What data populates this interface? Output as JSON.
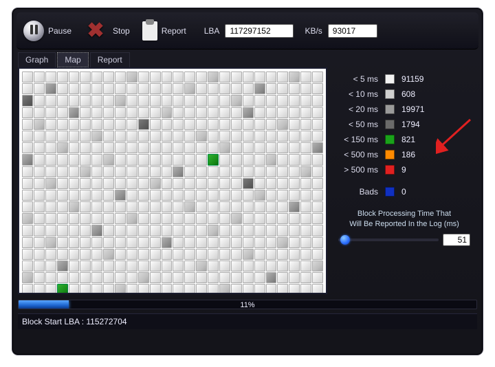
{
  "toolbar": {
    "pause_label": "Pause",
    "stop_label": "Stop",
    "report_label": "Report",
    "lba_label": "LBA",
    "lba_value": "117297152",
    "kbs_label": "KB/s",
    "kbs_value": "93017"
  },
  "tabs": {
    "graph": "Graph",
    "map": "Map",
    "report": "Report",
    "active": "map"
  },
  "legend": [
    {
      "threshold": "< 5 ms",
      "color": "#f2f2f2",
      "count": "91159"
    },
    {
      "threshold": "< 10 ms",
      "color": "#cfcfcf",
      "count": "608"
    },
    {
      "threshold": "< 20 ms",
      "color": "#9a9a9a",
      "count": "19971"
    },
    {
      "threshold": "< 50 ms",
      "color": "#6a6a6a",
      "count": "1794"
    },
    {
      "threshold": "< 150 ms",
      "color": "#1aa21a",
      "count": "821"
    },
    {
      "threshold": "< 500 ms",
      "color": "#ff8a00",
      "count": "186"
    },
    {
      "threshold": "> 500 ms",
      "color": "#e02020",
      "count": "9"
    },
    {
      "threshold": "Bads",
      "color": "#1030c0",
      "count": "0"
    }
  ],
  "slider": {
    "note_line1": "Block Processing Time That",
    "note_line2": "Will Be Reported In the Log (ms)",
    "value": "51",
    "pct": 2
  },
  "progress": {
    "percent_text": "11%",
    "percent": 11
  },
  "status": {
    "label": "Block Start LBA : 115272704"
  },
  "map": {
    "cols": 26,
    "rows": 19,
    "overrides": {
      "0-9": "g1",
      "0-16": "g1",
      "0-23": "g1",
      "1-2": "g2",
      "1-14": "g1",
      "1-20": "g2",
      "2-0": "g3",
      "2-8": "g1",
      "2-18": "g1",
      "3-4": "g2",
      "3-12": "g1",
      "3-19": "g2",
      "4-1": "g1",
      "4-10": "g3",
      "4-22": "g1",
      "5-6": "g1",
      "5-15": "g1",
      "6-3": "g1",
      "6-17": "g1",
      "6-25": "g2",
      "7-0": "g2",
      "7-7": "g1",
      "7-16": "green",
      "7-21": "g1",
      "8-5": "g1",
      "8-13": "g2",
      "8-24": "g1",
      "9-2": "g1",
      "9-11": "g1",
      "9-19": "g3",
      "10-8": "g2",
      "10-20": "g1",
      "11-4": "g1",
      "11-14": "g1",
      "11-23": "g2",
      "12-0": "g1",
      "12-9": "g1",
      "12-18": "g1",
      "13-6": "g2",
      "13-16": "g1",
      "14-2": "g1",
      "14-12": "g2",
      "14-22": "g1",
      "15-7": "g1",
      "15-19": "g1",
      "16-3": "g2",
      "16-15": "g1",
      "16-25": "g1",
      "17-0": "g1",
      "17-10": "g1",
      "17-21": "g2",
      "18-3": "green",
      "18-8": "g1",
      "18-17": "g1"
    }
  },
  "colors": {
    "accent": "#2a6cff"
  }
}
